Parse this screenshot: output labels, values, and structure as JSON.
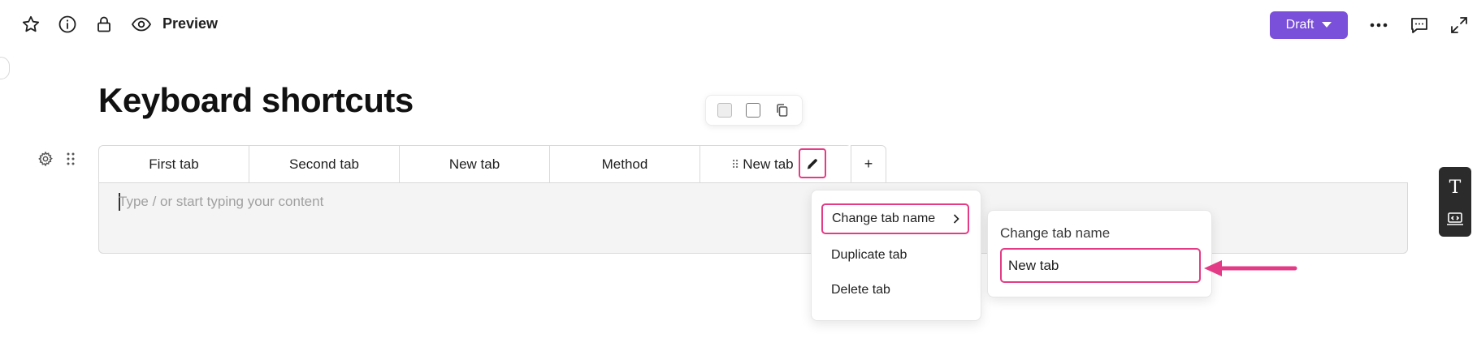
{
  "header": {
    "preview_label": "Preview",
    "draft_label": "Draft"
  },
  "page": {
    "title": "Keyboard shortcuts"
  },
  "tabs": [
    {
      "label": "First tab"
    },
    {
      "label": "Second tab"
    },
    {
      "label": "New tab"
    },
    {
      "label": "Method"
    },
    {
      "label": "New tab",
      "active": true
    }
  ],
  "add_tab_label": "+",
  "editor": {
    "placeholder": "Type / or start typing your content"
  },
  "context_menu": {
    "items": [
      {
        "label": "Change tab name"
      },
      {
        "label": "Duplicate tab"
      },
      {
        "label": "Delete tab"
      }
    ]
  },
  "rename_panel": {
    "title": "Change tab name",
    "input_value": "New tab"
  },
  "side_toolbar": {
    "text_tool_label": "T"
  },
  "colors": {
    "accent": "#7a4fd9",
    "highlight": "#e43b86",
    "toolbar_dark": "#2b2b2b"
  }
}
